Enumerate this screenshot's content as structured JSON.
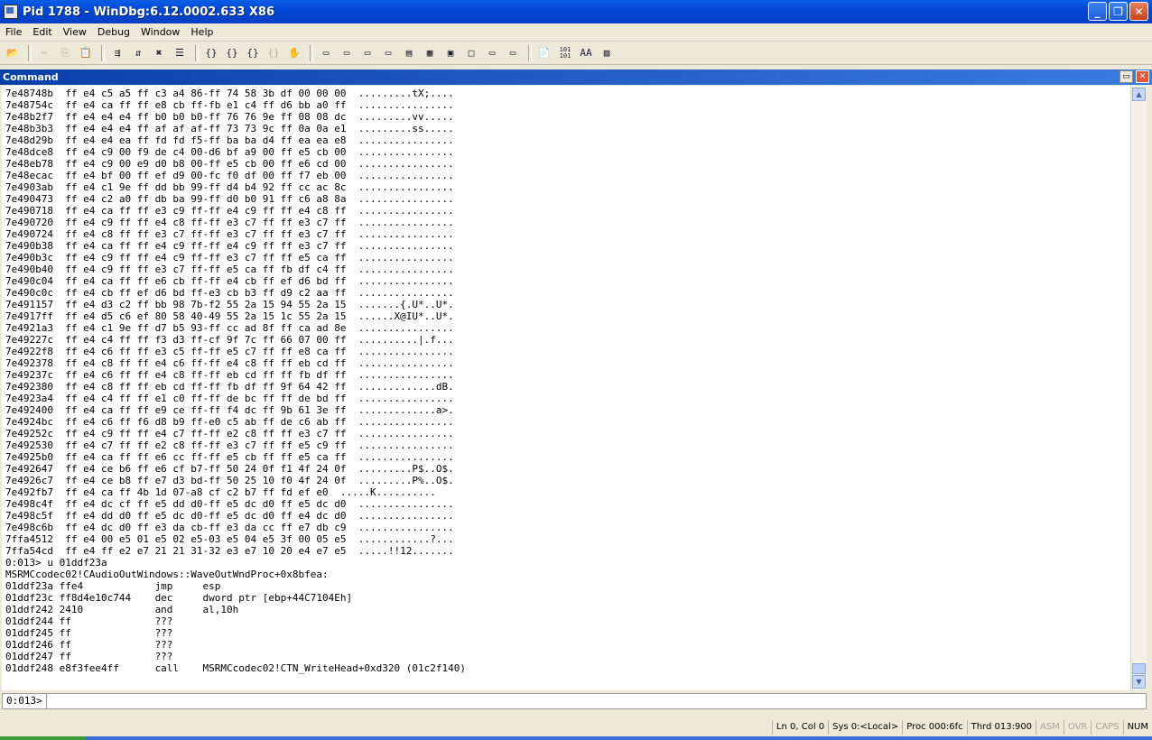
{
  "window": {
    "title": "Pid 1788 - WinDbg:6.12.0002.633 X86",
    "minimize": "_",
    "maximize": "❐",
    "close": "✕"
  },
  "menu": [
    "File",
    "Edit",
    "View",
    "Debug",
    "Window",
    "Help"
  ],
  "toolbar": {
    "icons": [
      "open-icon",
      "cut-icon",
      "copy-icon",
      "paste-icon",
      "go-icon",
      "restart-icon",
      "stop-debugging-icon",
      "break-icon",
      "step-into-icon",
      "step-over-icon",
      "step-out-icon",
      "run-to-cursor-icon",
      "breakpoint-icon",
      "command-icon",
      "watch-icon",
      "locals-icon",
      "registers-icon",
      "memory-icon",
      "call-stack-icon",
      "disassembly-icon",
      "scratch-pad-icon",
      "source-mode-icon",
      "hex-icon",
      "font-icon",
      "options-icon"
    ],
    "hex_label": "101\n101",
    "font_label": "AA"
  },
  "command_window": {
    "title": "Command",
    "output": "7e48748b  ff e4 c5 a5 ff c3 a4 86-ff 74 58 3b df 00 00 00  .........tX;....\n7e48754c  ff e4 ca ff ff e8 cb ff-fb e1 c4 ff d6 bb a0 ff  ................\n7e48b2f7  ff e4 e4 e4 ff b0 b0 b0-ff 76 76 9e ff 08 08 dc  .........vv.....\n7e48b3b3  ff e4 e4 e4 ff af af af-ff 73 73 9c ff 0a 0a e1  .........ss.....\n7e48d29b  ff e4 e4 ea ff fd fd f5-ff ba ba d4 ff ea ea e8  ................\n7e48dce8  ff e4 c9 00 f9 de c4 00-d6 bf a9 00 ff e5 cb 00  ................\n7e48eb78  ff e4 c9 00 e9 d0 b8 00-ff e5 cb 00 ff e6 cd 00  ................\n7e48ecac  ff e4 bf 00 ff ef d9 00-fc f0 df 00 ff f7 eb 00  ................\n7e4903ab  ff e4 c1 9e ff dd bb 99-ff d4 b4 92 ff cc ac 8c  ................\n7e490473  ff e4 c2 a0 ff db ba 99-ff d0 b0 91 ff c6 a8 8a  ................\n7e490718  ff e4 ca ff ff e3 c9 ff-ff e4 c9 ff ff e4 c8 ff  ................\n7e490720  ff e4 c9 ff ff e4 c8 ff-ff e3 c7 ff ff e3 c7 ff  ................\n7e490724  ff e4 c8 ff ff e3 c7 ff-ff e3 c7 ff ff e3 c7 ff  ................\n7e490b38  ff e4 ca ff ff e4 c9 ff-ff e4 c9 ff ff e3 c7 ff  ................\n7e490b3c  ff e4 c9 ff ff e4 c9 ff-ff e3 c7 ff ff e5 ca ff  ................\n7e490b40  ff e4 c9 ff ff e3 c7 ff-ff e5 ca ff fb df c4 ff  ................\n7e490c04  ff e4 ca ff ff e6 cb ff-ff e4 cb ff ef d6 bd ff  ................\n7e490c0c  ff e4 cb ff ef d6 bd ff-e3 cb b3 ff d9 c2 aa ff  ................\n7e491157  ff e4 d3 c2 ff bb 98 7b-f2 55 2a 15 94 55 2a 15  .......{.U*..U*.\n7e4917ff  ff e4 d5 c6 ef 80 58 40-49 55 2a 15 1c 55 2a 15  ......X@IU*..U*.\n7e4921a3  ff e4 c1 9e ff d7 b5 93-ff cc ad 8f ff ca ad 8e  ................\n7e49227c  ff e4 c4 ff ff f3 d3 ff-cf 9f 7c ff 66 07 00 ff  ..........|.f...\n7e4922f8  ff e4 c6 ff ff e3 c5 ff-ff e5 c7 ff ff e8 ca ff  ................\n7e492378  ff e4 c8 ff ff e4 c6 ff-ff e4 c8 ff ff eb cd ff  ................\n7e49237c  ff e4 c6 ff ff e4 c8 ff-ff eb cd ff ff fb df ff  ................\n7e492380  ff e4 c8 ff ff eb cd ff-ff fb df ff 9f 64 42 ff  .............dB.\n7e4923a4  ff e4 c4 ff ff e1 c0 ff-ff de bc ff ff de bd ff  ................\n7e492400  ff e4 ca ff ff e9 ce ff-ff f4 dc ff 9b 61 3e ff  .............a>.\n7e4924bc  ff e4 c6 ff f6 d8 b9 ff-e0 c5 ab ff de c6 ab ff  ................\n7e49252c  ff e4 c9 ff ff e4 c7 ff-ff e2 c8 ff ff e3 c7 ff  ................\n7e492530  ff e4 c7 ff ff e2 c8 ff-ff e3 c7 ff ff e5 c9 ff  ................\n7e4925b0  ff e4 ca ff ff e6 cc ff-ff e5 cb ff ff e5 ca ff  ................\n7e492647  ff e4 ce b6 ff e6 cf b7-ff 50 24 0f f1 4f 24 0f  .........P$..O$.\n7e4926c7  ff e4 ce b8 ff e7 d3 bd-ff 50 25 10 f0 4f 24 0f  .........P%..O$.\n7e492fb7  ff e4 ca ff 4b 1d 07-a8 cf c2 b7 ff fd ef e0  .....K..........\n7e498c4f  ff e4 dc cf ff e5 dd d0-ff e5 dc d0 ff e5 dc d0  ................\n7e498c5f  ff e4 dd d0 ff e5 dc d0-ff e5 dc d0 ff e4 dc d0  ................\n7e498c6b  ff e4 dc d0 ff e3 da cb-ff e3 da cc ff e7 db c9  ................\n7ffa4512  ff e4 00 e5 01 e5 02 e5-03 e5 04 e5 3f 00 05 e5  ............?...\n7ffa54cd  ff e4 ff e2 e7 21 21 31-32 e3 e7 10 20 e4 e7 e5  .....!!12.......\n0:013> u 01ddf23a\nMSRMCcodec02!CAudioOutWindows::WaveOutWndProc+0x8bfea:\n01ddf23a ffe4            jmp     esp\n01ddf23c ff8d4e10c744    dec     dword ptr [ebp+44C7104Eh]\n01ddf242 2410            and     al,10h\n01ddf244 ff              ???\n01ddf245 ff              ???\n01ddf246 ff              ???\n01ddf247 ff              ???\n01ddf248 e8f3fee4ff      call    MSRMCcodec02!CTN_WriteHead+0xd320 (01c2f140)",
    "prompt": "0:013>",
    "input_value": ""
  },
  "status": {
    "ln_col": "Ln 0, Col 0",
    "sys": "Sys 0:<Local>",
    "proc": "Proc 000:6fc",
    "thrd": "Thrd 013:900",
    "asm": "ASM",
    "ovr": "OVR",
    "caps": "CAPS",
    "num": "NUM"
  }
}
